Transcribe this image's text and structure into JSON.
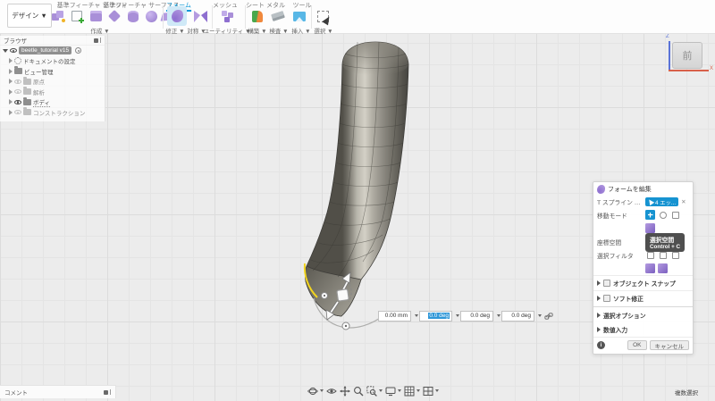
{
  "toolbar": {
    "workspace": "デザイン ▼",
    "tabs": [
      "基準フィーチャ ソリッド",
      "基準フィーチャ サーフェス",
      "フォーム",
      "メッシュ",
      "シート メタル",
      "ツール"
    ],
    "active_tab": "フォーム",
    "groups": [
      "作成 ▼",
      "修正 ▼",
      "対称 ▼",
      "ユーティリティ ▼",
      "構築 ▼",
      "検査 ▼",
      "挿入 ▼",
      "選択 ▼"
    ]
  },
  "browser": {
    "title": "ブラウザ",
    "root_name": "beetle_tutorial v15",
    "items": [
      "ドキュメントの設定",
      "ビュー管理",
      "原点",
      "解析",
      "ボディ",
      "コンストラクション"
    ]
  },
  "viewcube": {
    "face": "前",
    "z_label": "Z",
    "x_label": "X"
  },
  "transform_bar": {
    "values": [
      "0.00 mm",
      "0.0 deg",
      "0.0 deg",
      "0.0 deg"
    ],
    "selected_index": 1
  },
  "dialog": {
    "title": "フォームを編集",
    "entity_label": "T スプライン エンティ...",
    "entity_value": "4 エッ...",
    "close_glyph": "✕",
    "move_mode_label": "移動モード",
    "coord_space_label": "座標空間",
    "filter_label": "選択フィルタ",
    "sections": [
      "オブジェクト スナップ",
      "ソフト修正",
      "選択オプション",
      "数値入力"
    ],
    "ok_label": "OK",
    "cancel_label": "キャンセル"
  },
  "tooltip": {
    "title": "選択空間",
    "shortcut": "Control + C"
  },
  "comment_panel": {
    "title": "コメント"
  },
  "status_bar": {
    "selection_mode": "複数選択"
  },
  "colors": {
    "accent": "#0696d7",
    "selection_yellow": "#f2d41e",
    "icon_purple": "#a98fd8",
    "tooltip_bg": "#4f4f4f"
  }
}
